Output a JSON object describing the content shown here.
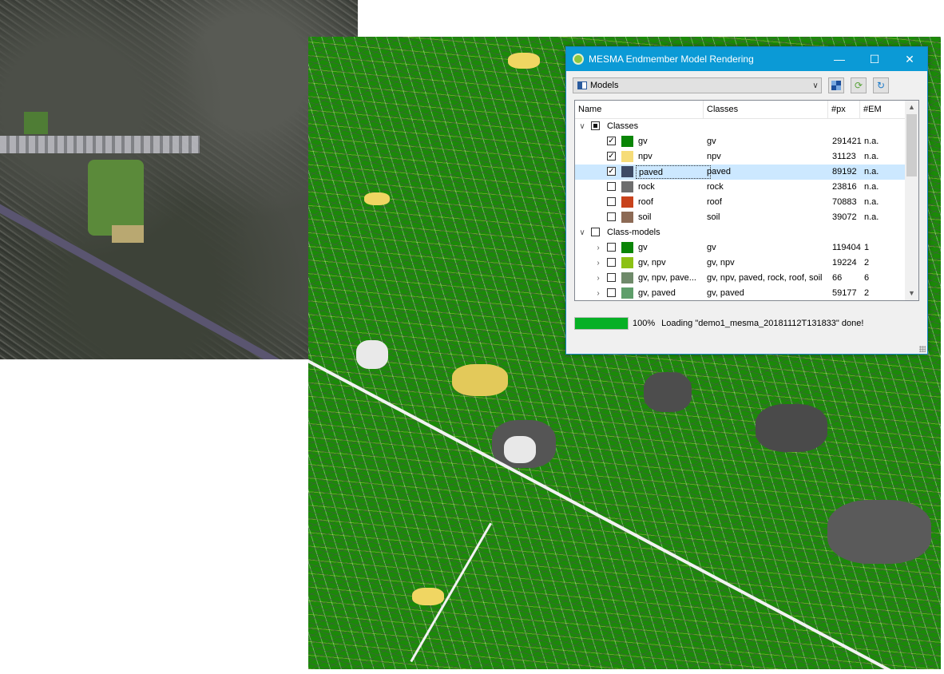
{
  "window": {
    "title": "MESMA Endmember Model Rendering",
    "minimize": "—",
    "maximize": "☐",
    "close": "✕"
  },
  "toolbar": {
    "combo_value": "Models",
    "combo_icon": "models-icon",
    "buttons": [
      "select-icon",
      "refresh-green-icon",
      "reload-blue-icon"
    ]
  },
  "tree": {
    "headers": [
      "Name",
      "Classes",
      "#px",
      "#EM"
    ],
    "rows": [
      {
        "level": 0,
        "expander": "∨",
        "check": "partial",
        "name": "Classes",
        "classes": "",
        "px": "",
        "em": "",
        "color": null
      },
      {
        "level": 1,
        "expander": "",
        "check": "checked",
        "name": "gv",
        "classes": "gv",
        "px": "291421",
        "em": "n.a.",
        "color": "#0a8506"
      },
      {
        "level": 1,
        "expander": "",
        "check": "checked",
        "name": "npv",
        "classes": "npv",
        "px": "31123",
        "em": "n.a.",
        "color": "#f6dc78"
      },
      {
        "level": 1,
        "expander": "",
        "check": "checked",
        "name": "paved",
        "classes": "paved",
        "px": "89192",
        "em": "n.a.",
        "color": "#3d4a64",
        "selected": true
      },
      {
        "level": 1,
        "expander": "",
        "check": "unchecked",
        "name": "rock",
        "classes": "rock",
        "px": "23816",
        "em": "n.a.",
        "color": "#6e6e6e"
      },
      {
        "level": 1,
        "expander": "",
        "check": "unchecked",
        "name": "roof",
        "classes": "roof",
        "px": "70883",
        "em": "n.a.",
        "color": "#c8421c"
      },
      {
        "level": 1,
        "expander": "",
        "check": "unchecked",
        "name": "soil",
        "classes": "soil",
        "px": "39072",
        "em": "n.a.",
        "color": "#8c6a55"
      },
      {
        "level": 0,
        "expander": "∨",
        "check": "unchecked",
        "name": "Class-models",
        "classes": "",
        "px": "",
        "em": "",
        "color": null
      },
      {
        "level": 1,
        "expander": "›",
        "check": "unchecked",
        "name": "gv",
        "classes": "gv",
        "px": "119404",
        "em": "1",
        "color": "#0a8506"
      },
      {
        "level": 1,
        "expander": "›",
        "check": "unchecked",
        "name": "gv, npv",
        "classes": "gv, npv",
        "px": "19224",
        "em": "2",
        "color": "#8cc114"
      },
      {
        "level": 1,
        "expander": "›",
        "check": "unchecked",
        "name": "gv, npv, pave...",
        "classes": "gv, npv, paved, rock, roof, soil",
        "px": "66",
        "em": "6",
        "color": "#6f8a6a"
      },
      {
        "level": 1,
        "expander": "›",
        "check": "unchecked",
        "name": "gv, paved",
        "classes": "gv, paved",
        "px": "59177",
        "em": "2",
        "color": "#5e9e6a"
      }
    ]
  },
  "status": {
    "progress": 1.0,
    "percent_text": "100%",
    "message": "Loading \"demo1_mesma_20181112T131833\" done!"
  },
  "colors": {
    "titlebar": "#0b9ad6",
    "progress": "#06b025",
    "map_gv": "#1b8a08",
    "map_npv": "#f0d662",
    "map_paved": "#555555"
  }
}
